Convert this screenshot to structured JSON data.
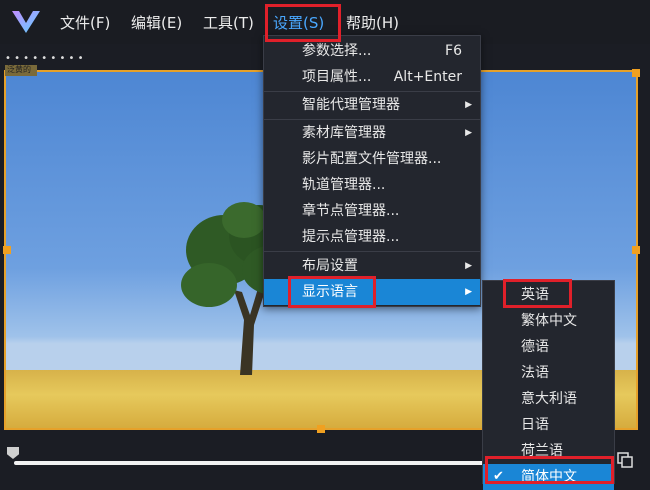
{
  "menubar": {
    "items": [
      {
        "label": "文件(F)"
      },
      {
        "label": "编辑(E)"
      },
      {
        "label": "工具(T)"
      },
      {
        "label": "设置(S)"
      },
      {
        "label": "帮助(H)"
      }
    ]
  },
  "settings_menu": {
    "items": [
      {
        "label": "参数选择...",
        "shortcut": "F6"
      },
      {
        "label": "项目属性...",
        "shortcut": "Alt+Enter"
      },
      {
        "label": "智能代理管理器",
        "has_submenu": true
      },
      {
        "label": "素材库管理器",
        "has_submenu": true
      },
      {
        "label": "影片配置文件管理器..."
      },
      {
        "label": "轨道管理器..."
      },
      {
        "label": "章节点管理器..."
      },
      {
        "label": "提示点管理器..."
      },
      {
        "label": "布局设置",
        "has_submenu": true
      },
      {
        "label": "显示语言",
        "has_submenu": true,
        "highlighted": true
      }
    ]
  },
  "language_submenu": {
    "items": [
      {
        "label": "英语"
      },
      {
        "label": "繁体中文"
      },
      {
        "label": "德语"
      },
      {
        "label": "法语"
      },
      {
        "label": "意大利语"
      },
      {
        "label": "日语"
      },
      {
        "label": "荷兰语"
      },
      {
        "label": "简体中文",
        "checked": true,
        "highlighted": true
      }
    ]
  },
  "preview": {
    "thumbnail_label": "泛黄的"
  },
  "colors": {
    "accent": "#1a86d6",
    "annotation": "#e0202a",
    "border": "#e6a12a"
  }
}
